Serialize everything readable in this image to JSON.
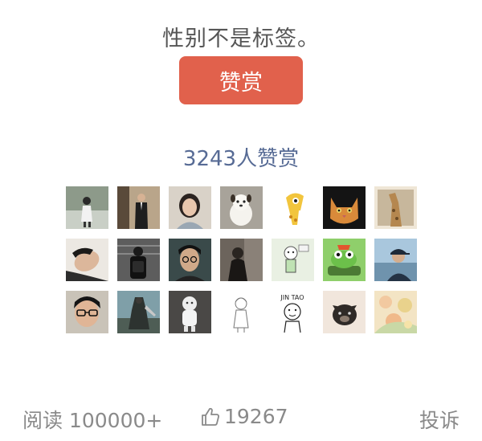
{
  "article": {
    "closing_line": "性别不是标签。"
  },
  "reward": {
    "button_label": "赞赏",
    "count": "3243",
    "count_suffix": "人赞赏",
    "avatars": [
      "person-standing",
      "man-suit",
      "woman-smiling",
      "white-puppy",
      "cartoon-giraffe",
      "orange-cat",
      "giraffe-photo",
      "man-lying",
      "person-backpack",
      "man-glasses",
      "person-dark",
      "cartoon-figure",
      "frog-tank",
      "man-cap-sea",
      "man-glasses-face",
      "game-character",
      "white-figurine",
      "sketch-girl",
      "jintao-doodle",
      "bulldog",
      "floral-art"
    ]
  },
  "footer": {
    "read_label": "阅读",
    "read_count": "100000+",
    "like_count": "19267",
    "report_label": "投诉"
  },
  "colors": {
    "accent": "#e1614c",
    "link": "#576b95",
    "muted": "#8a8a8a"
  },
  "icons": {
    "like": "thumbs-up-icon"
  }
}
